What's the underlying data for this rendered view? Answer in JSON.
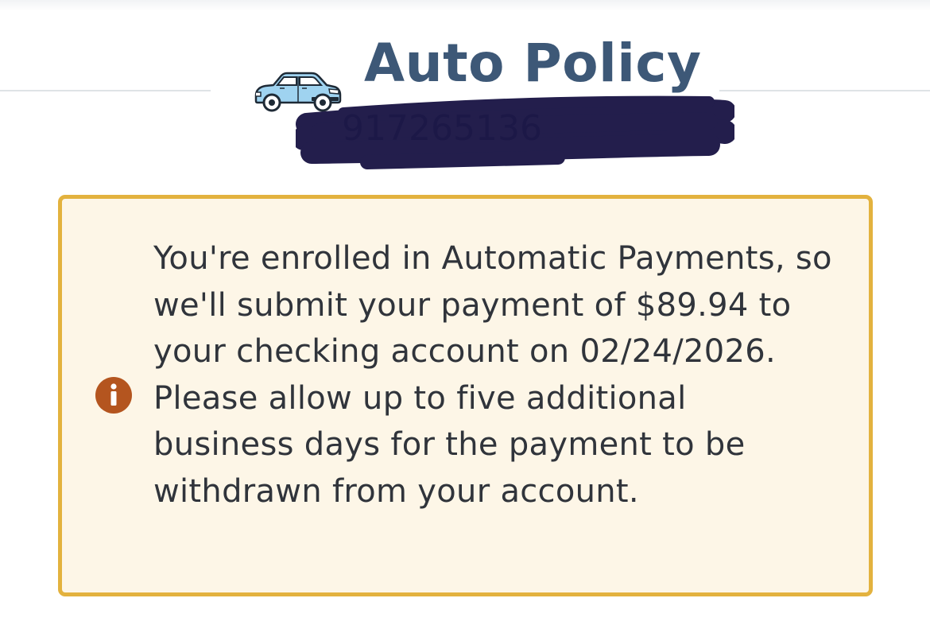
{
  "header": {
    "title": "Auto Policy",
    "car_icon": "car-icon",
    "policy_number": "917265136"
  },
  "notice": {
    "icon": "info-icon",
    "message": "You're enrolled in Automatic Payments, so we'll submit your payment of $89.94 to your checking account on 02/24/2026. Please allow up to five additional business days for the payment to be withdrawn from your account."
  },
  "colors": {
    "title": "#3d5877",
    "notice_border": "#e3b23e",
    "notice_background": "#fdf6e7",
    "info_icon": "#b4551f",
    "redaction_ink": "#1c1747",
    "car_body": "#9fd3f0"
  }
}
